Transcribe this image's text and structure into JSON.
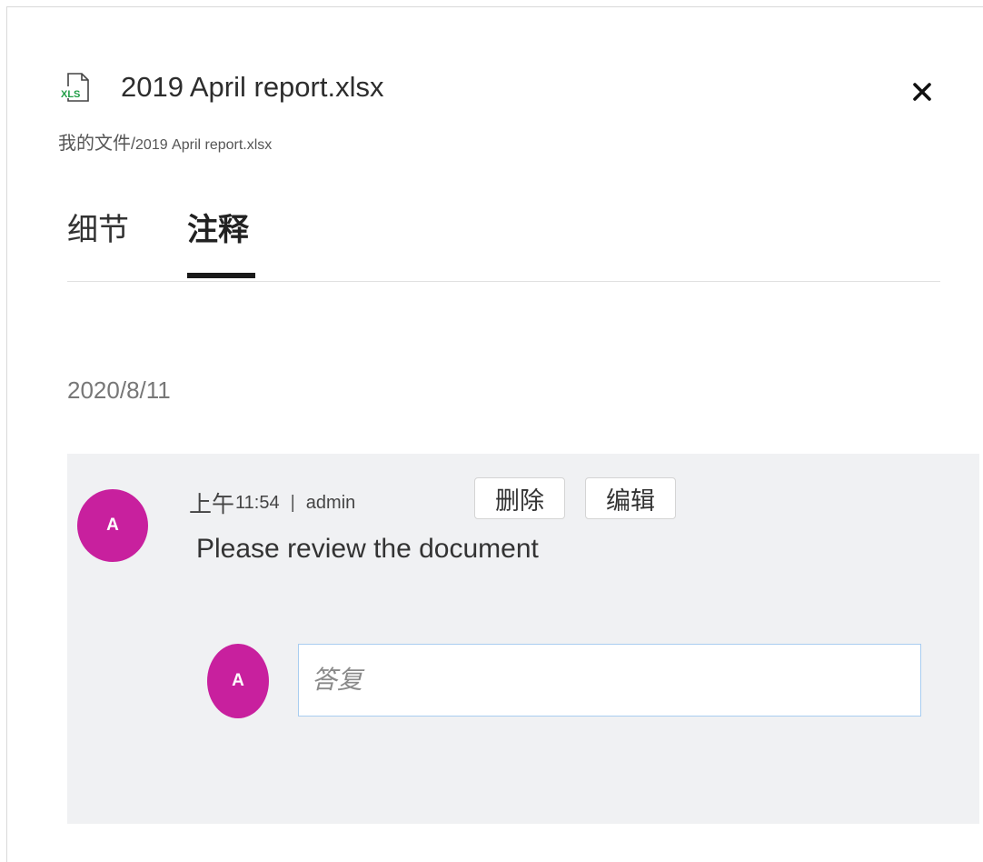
{
  "header": {
    "file_icon": "xls-file-icon",
    "file_icon_label": "XLS",
    "title": "2019 April report.xlsx",
    "close_icon": "close-icon"
  },
  "breadcrumb": {
    "folder": "我的文件",
    "separator": "/",
    "file": "2019 April report.xlsx"
  },
  "tabs": [
    {
      "label": "细节",
      "active": false
    },
    {
      "label": "注释",
      "active": true
    }
  ],
  "comments": {
    "date": "2020/8/11",
    "items": [
      {
        "avatar": "A",
        "ampm": "上午",
        "time": "11:54",
        "separator": "|",
        "user": "admin",
        "delete_label": "删除",
        "edit_label": "编辑",
        "text": "Please review the document"
      }
    ],
    "reply": {
      "avatar": "A",
      "placeholder": "答复"
    }
  },
  "colors": {
    "avatar": "#c8209e",
    "xls_green": "#1f9d45",
    "comment_bg": "#f0f1f3",
    "input_border": "#a9cdf0"
  }
}
